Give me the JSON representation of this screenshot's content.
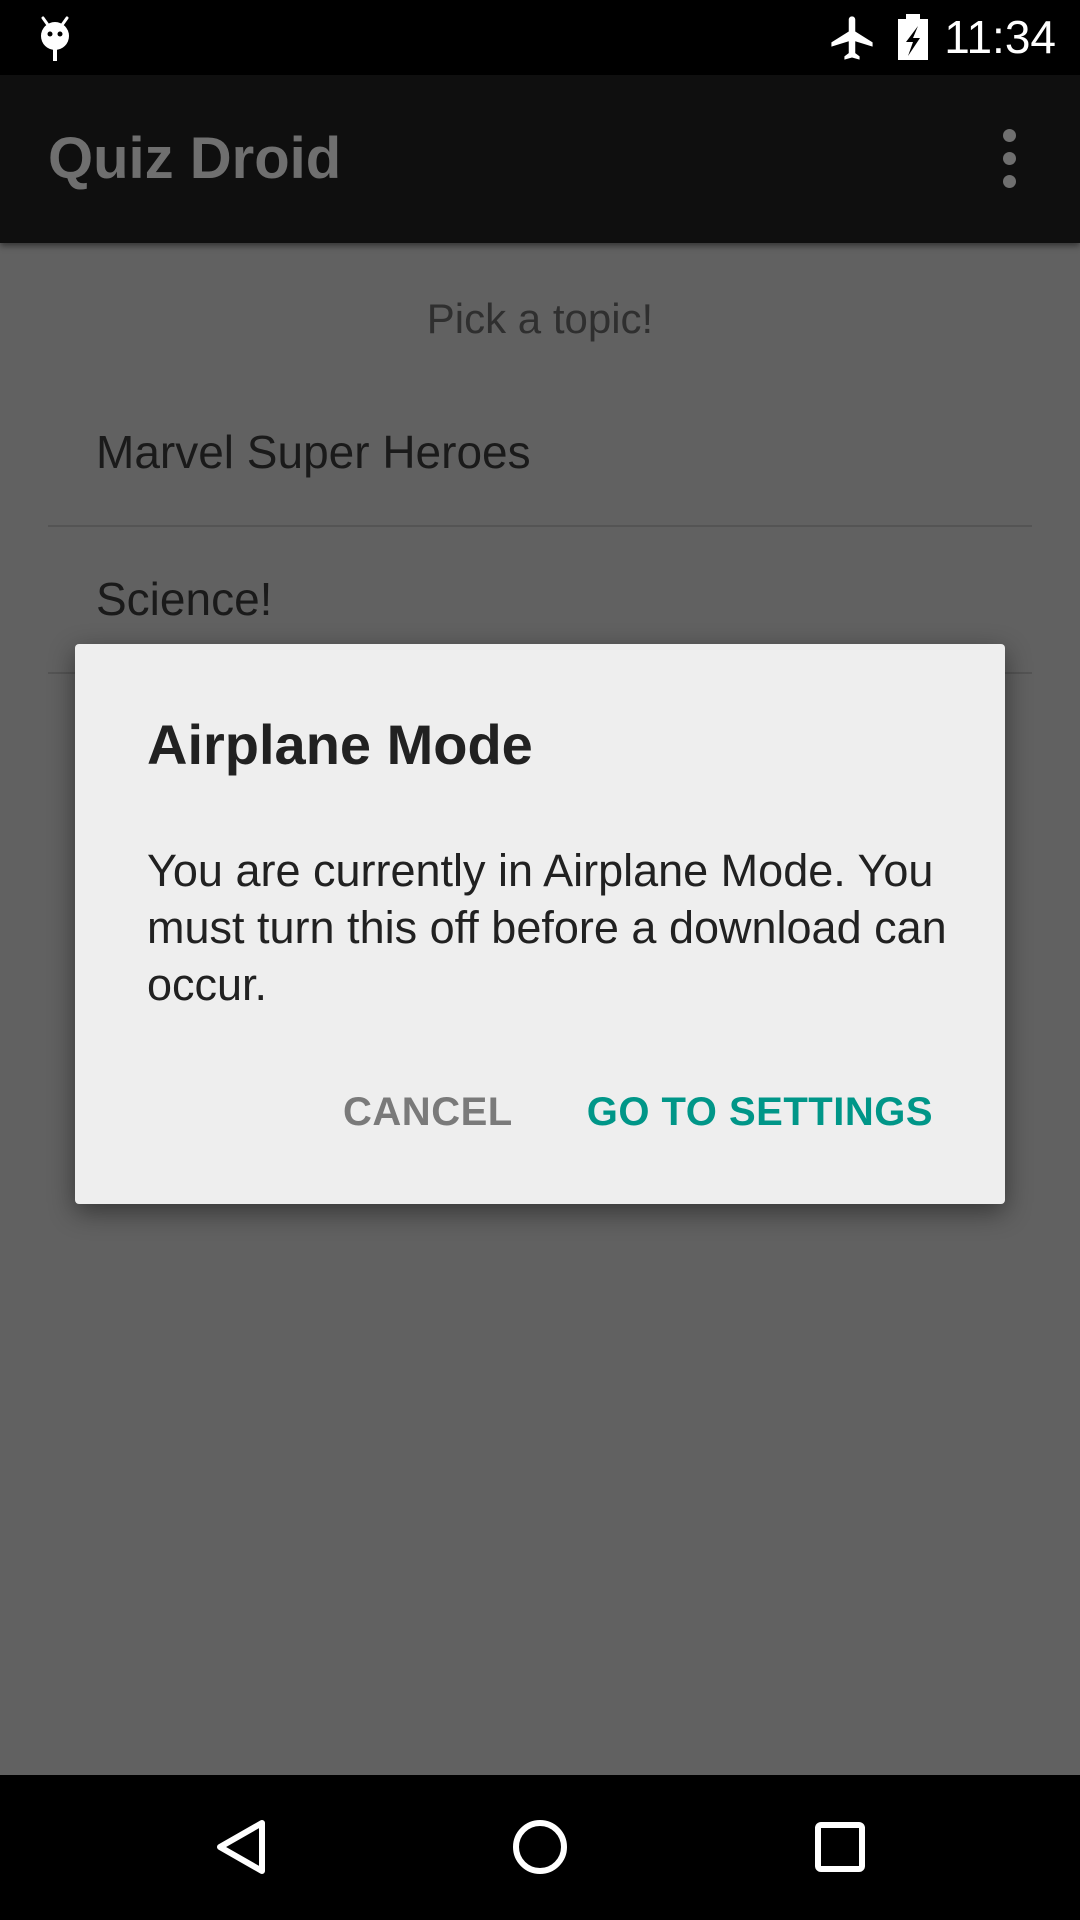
{
  "status_bar": {
    "time": "11:34",
    "icons": [
      "android-debug-icon",
      "airplane-mode-icon",
      "battery-charging-icon"
    ]
  },
  "app_bar": {
    "title": "Quiz Droid",
    "menu_icon": "overflow-menu-icon"
  },
  "content": {
    "prompt": "Pick a topic!",
    "topics": [
      {
        "label": "Marvel Super Heroes"
      },
      {
        "label": "Science!"
      }
    ]
  },
  "dialog": {
    "title": "Airplane Mode",
    "message": "You are currently in Airplane Mode. You must turn this off before a download can occur.",
    "cancel_label": "CANCEL",
    "confirm_label": "GO TO SETTINGS"
  },
  "nav_bar": {
    "icons": [
      "back-icon",
      "home-icon",
      "recents-icon"
    ]
  },
  "colors": {
    "accent": "#009688",
    "scrim_background": "#616161",
    "dialog_background": "#eeeeee",
    "app_bar": "#0f0f0f",
    "system_bars": "#000000"
  }
}
